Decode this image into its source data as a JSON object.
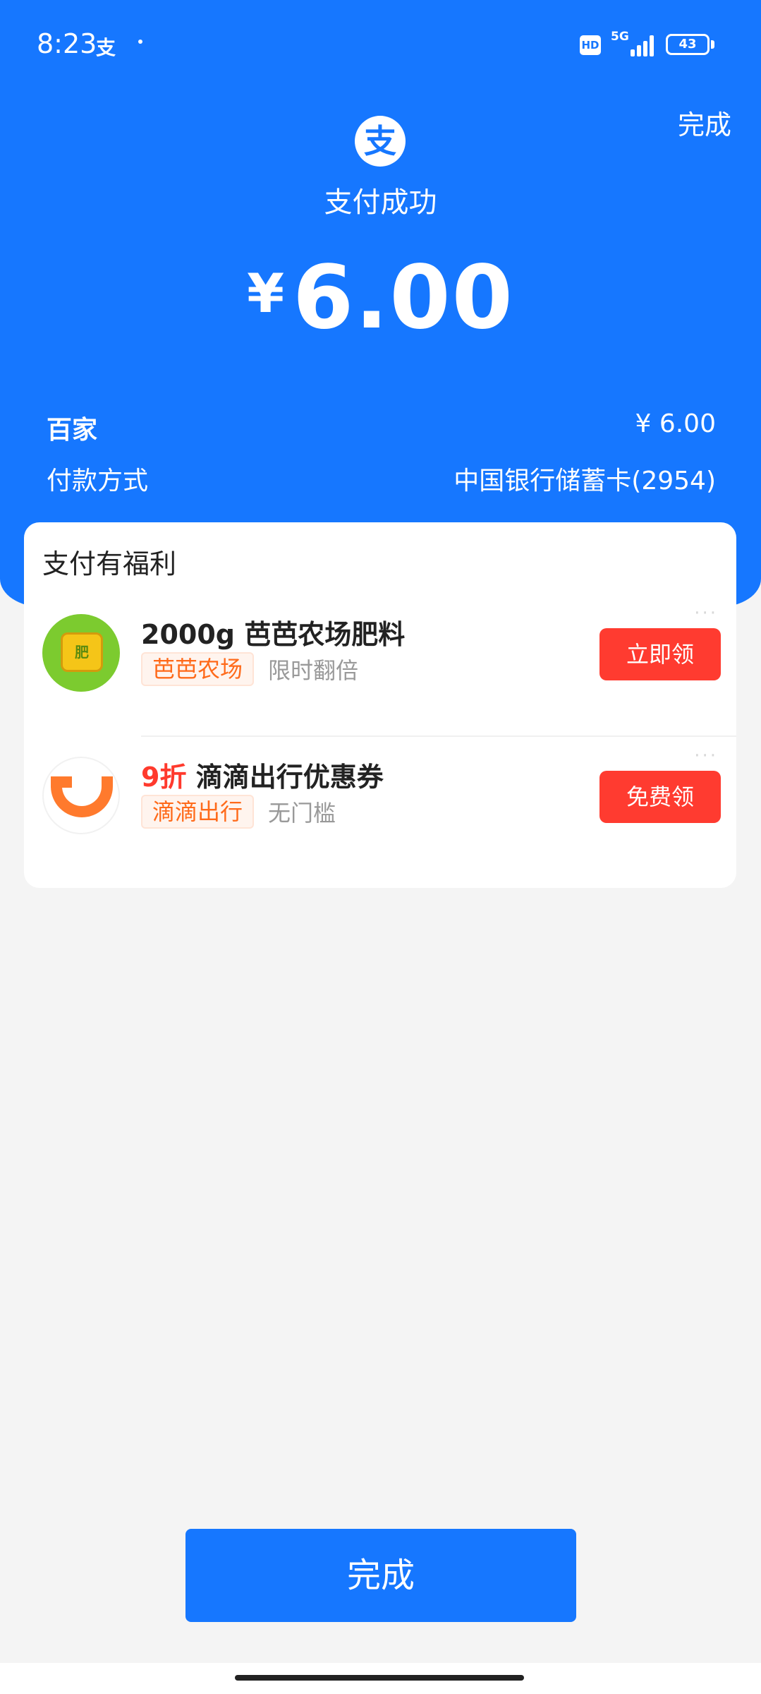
{
  "status_bar": {
    "time": "8:23",
    "alipay_glyph": "支",
    "hd": "HD",
    "network": "5G",
    "battery": "43"
  },
  "header": {
    "done_label": "完成",
    "logo_glyph": "支",
    "title": "支付成功",
    "currency": "¥",
    "amount": "6.00"
  },
  "details": {
    "merchant": "百家",
    "merchant_amount": "¥ 6.00",
    "payment_method_label": "付款方式",
    "payment_method_value": "中国银行储蓄卡(2954)"
  },
  "benefits": {
    "title": "支付有福利",
    "offers": [
      {
        "icon": "baba-farm-fertilizer-icon",
        "icon_text": "肥",
        "title": "2000g 芭芭农场肥料",
        "tag": "芭芭农场",
        "note": "限时翻倍",
        "button": "立即领",
        "more": "···"
      },
      {
        "icon": "didi-logo-icon",
        "highlight": "9折",
        "title": "滴滴出行优惠券",
        "tag": "滴滴出行",
        "note": "无门槛",
        "button": "免费领",
        "more": "···"
      }
    ]
  },
  "footer": {
    "done_label": "完成"
  },
  "colors": {
    "brand_blue": "#1677ff",
    "claim_red": "#ff3b30",
    "tag_orange": "#ff6a1a"
  }
}
